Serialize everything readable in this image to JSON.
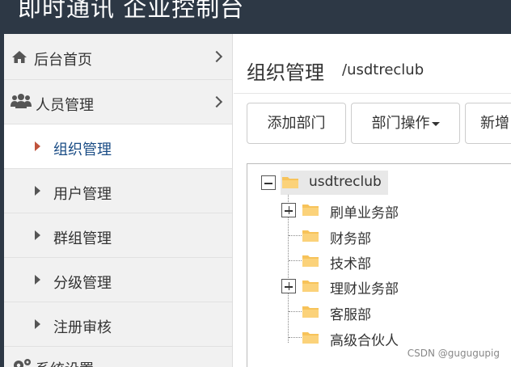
{
  "app": {
    "title": "即时通讯 企业控制台"
  },
  "sidebar": {
    "items": [
      {
        "label": "后台首页",
        "icon": "home-icon"
      },
      {
        "label": "人员管理",
        "icon": "users-icon"
      },
      {
        "label": "组织管理",
        "active": true
      },
      {
        "label": "用户管理"
      },
      {
        "label": "群组管理"
      },
      {
        "label": "分级管理"
      },
      {
        "label": "注册审核"
      },
      {
        "label": "系统设置",
        "icon": "gear-icon"
      }
    ]
  },
  "main": {
    "title": "组织管理",
    "subtitle": "/usdtreclub",
    "buttons": [
      {
        "label": "添加部门"
      },
      {
        "label": "部门操作"
      },
      {
        "label": "新增"
      }
    ],
    "tree": {
      "root": "usdtreclub",
      "children": [
        {
          "label": "刷单业务部",
          "expandable": true
        },
        {
          "label": "财务部",
          "expandable": false
        },
        {
          "label": "技术部",
          "expandable": false
        },
        {
          "label": "理财业务部",
          "expandable": true
        },
        {
          "label": "客服部",
          "expandable": false
        },
        {
          "label": "高级合伙人",
          "expandable": false
        }
      ]
    }
  },
  "watermark": "CSDN @gugugupig",
  "colors": {
    "topbar": "#2d3845",
    "active_text": "#1a4c85",
    "active_caret": "#c0533c",
    "folder": "#f7c35a"
  }
}
